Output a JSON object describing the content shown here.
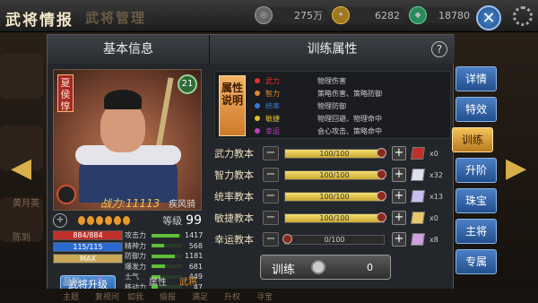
{
  "header": {
    "title": "武将情报",
    "subtitle": "武将管理"
  },
  "resources": [
    {
      "icon": "copper-coin-icon",
      "value": "275万"
    },
    {
      "icon": "gold-ingot-icon",
      "value": "6282"
    },
    {
      "icon": "jade-gem-icon",
      "value": "18780"
    }
  ],
  "left_roster": [
    {
      "name": ""
    },
    {
      "name": "黄月英",
      "sub": "陈到"
    },
    {
      "name": ""
    }
  ],
  "basic_info": {
    "title": "基本信息",
    "name": "夏侯惇",
    "level_badge": "21",
    "power_label": "战力:",
    "power_value": "11113",
    "troop_type": "疾风骑",
    "stars": 6,
    "level_label": "等级",
    "level_value": "99",
    "upgrade_label": "武将升级",
    "grade_label": "品阶",
    "grade_value": "A",
    "attr_label": "属性",
    "attr_value": "武将"
  },
  "resource_bars": [
    {
      "text": "884/884",
      "fill": 1.0,
      "color": "#c0302a"
    },
    {
      "text": "115/115",
      "fill": 1.0,
      "color": "#2b6bd0"
    },
    {
      "text": "MAX",
      "fill": 1.0,
      "color": "#c9a85a"
    }
  ],
  "stats": [
    {
      "label": "攻击力",
      "value": "1417",
      "fill": 0.9
    },
    {
      "label": "精神力",
      "value": "568",
      "fill": 0.4
    },
    {
      "label": "防御力",
      "value": "1181",
      "fill": 0.75
    },
    {
      "label": "爆发力",
      "value": "681",
      "fill": 0.45
    },
    {
      "label": "士气",
      "value": "449",
      "fill": 0.3
    },
    {
      "label": "移动力",
      "value": "47",
      "fill": 0.2
    }
  ],
  "training": {
    "title": "训练属性",
    "help": "?",
    "legend_tag": "属性说明",
    "legend": [
      {
        "name": "武力",
        "desc": "物理伤害",
        "color": "#e03030"
      },
      {
        "name": "智力",
        "desc": "策略伤害、策略防御",
        "color": "#e08a2a"
      },
      {
        "name": "统率",
        "desc": "物理防御",
        "color": "#3a7ad8"
      },
      {
        "name": "敏捷",
        "desc": "物理回避、物理命中",
        "color": "#e0c02a"
      },
      {
        "name": "幸运",
        "desc": "会心攻击、策略命中",
        "color": "#c040c0"
      }
    ],
    "rows": [
      {
        "label": "武力教本",
        "value": "100/100",
        "fill": 1.0,
        "book": "#c0302a",
        "count": "x0"
      },
      {
        "label": "智力教本",
        "value": "100/100",
        "fill": 1.0,
        "book": "#e0e0f0",
        "count": "x32"
      },
      {
        "label": "统率教本",
        "value": "100/100",
        "fill": 1.0,
        "book": "#c8c0f0",
        "count": "x13"
      },
      {
        "label": "敏捷教本",
        "value": "100/100",
        "fill": 1.0,
        "book": "#e8c86a",
        "count": "x0"
      },
      {
        "label": "幸运教本",
        "value": "0/100",
        "fill": 0.0,
        "book": "#d0a0e0",
        "count": "x8"
      }
    ],
    "train_button": {
      "label": "训练",
      "cost": "0"
    }
  },
  "side_tabs": [
    "详情",
    "特效",
    "训练",
    "升阶",
    "珠宝",
    "主将",
    "专属"
  ],
  "active_tab": "训练",
  "bottom_tabs": [
    "主题",
    "复视问",
    "如我",
    "偷报",
    "满足",
    "升权",
    "寻宝"
  ]
}
